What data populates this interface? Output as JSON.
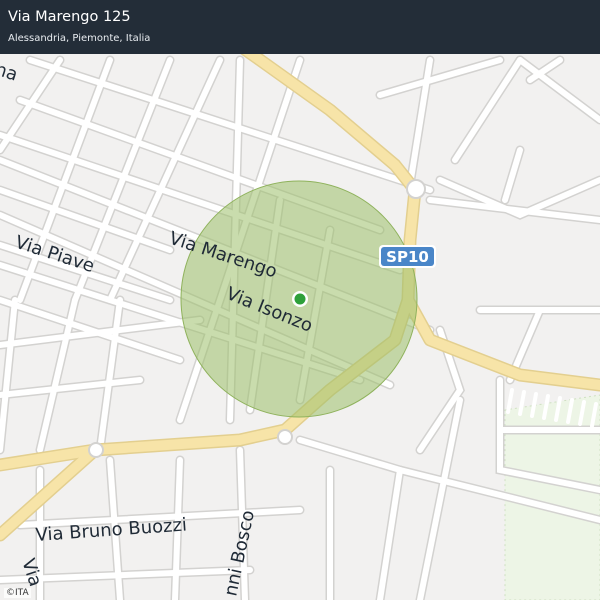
{
  "header": {
    "title": "Via Marengo 125",
    "subtitle": "Alessandria, Piemonte, Italia"
  },
  "map": {
    "labels": {
      "via_marengo": "Via  Marengo",
      "via_isonzo": "Via  Isonzo",
      "via_piave": "Via  Piave",
      "via_bruno_buozzi": "Via  Bruno  Buozzi",
      "via_bosco": "nni  Bosco",
      "edge_top_left": "na",
      "edge_bottom_left": "Via"
    },
    "road_shield": "SP10",
    "attribution": "©ITA",
    "colors": {
      "background": "#f2f1f0",
      "minor_road": "#ffffff",
      "road_casing": "#d3d2d0",
      "major_road": "#f7e4a8",
      "major_casing": "#e3cf8f",
      "accuracy_circle": "#9cc06a",
      "location_dot": "#2ea03a",
      "green_area": "#edf5e6",
      "shield": "#4a86c8"
    }
  }
}
